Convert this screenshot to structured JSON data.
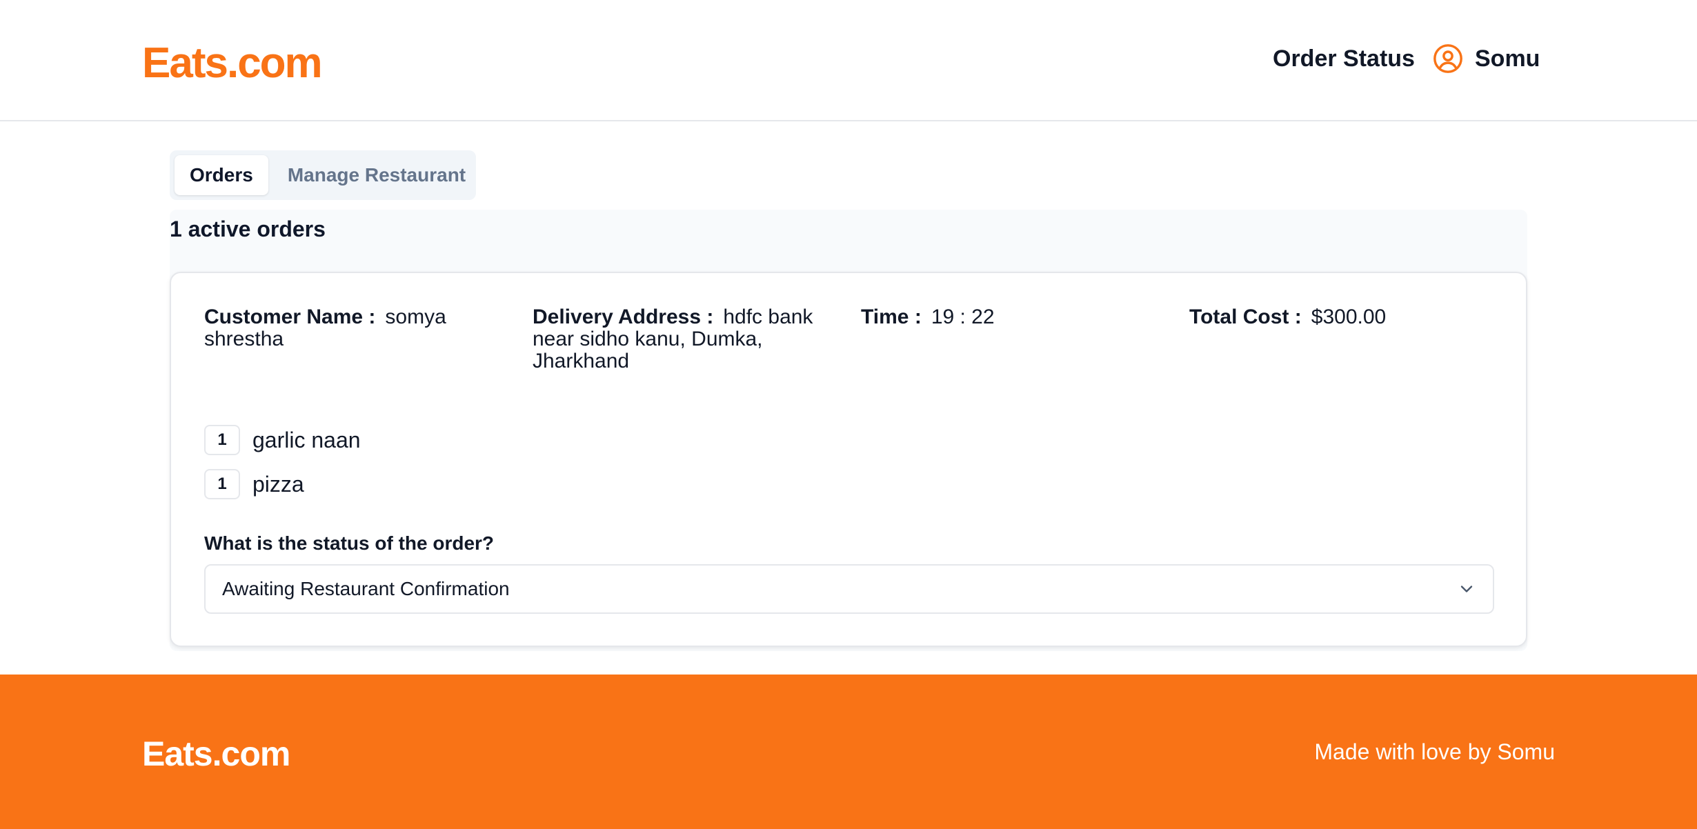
{
  "colors": {
    "brand": "#f97316",
    "text": "#0f172a",
    "muted": "#64748b",
    "border": "#e5e7eb"
  },
  "header": {
    "logo": "Eats.com",
    "order_status": "Order Status",
    "user_icon": "user-circle-icon",
    "user_name": "Somu"
  },
  "tabs": [
    {
      "label": "Orders",
      "active": true
    },
    {
      "label": "Manage Restaurant",
      "active": false
    }
  ],
  "orders": {
    "title": "1 active orders",
    "list": [
      {
        "customer_label": "Customer Name :",
        "customer_value": "somya shrestha",
        "address_label": "Delivery Address :",
        "address_value": "hdfc bank near sidho kanu, Dumka, Jharkhand",
        "time_label": "Time :",
        "time_value": "19 : 22",
        "cost_label": "Total Cost :",
        "cost_value": "$300.00",
        "items": [
          {
            "qty": "1",
            "name": "garlic naan"
          },
          {
            "qty": "1",
            "name": "pizza"
          }
        ],
        "status_question": "What is the status of the order?",
        "status_value": "Awaiting Restaurant Confirmation",
        "status_icon": "chevron-down-icon"
      }
    ]
  },
  "footer": {
    "logo": "Eats.com",
    "credit": "Made with love by Somu"
  }
}
